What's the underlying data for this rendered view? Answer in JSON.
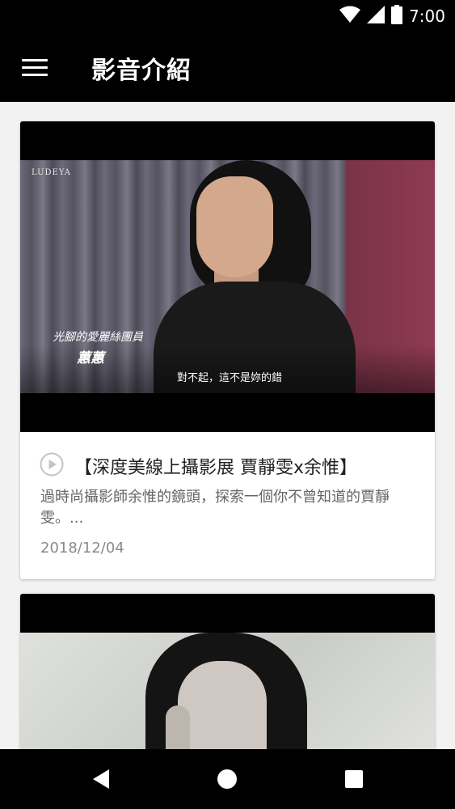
{
  "status_bar": {
    "time": "7:00",
    "icons": [
      "wifi-icon",
      "signal-icon",
      "battery-icon"
    ]
  },
  "app_bar": {
    "menu_icon": "hamburger-menu-icon",
    "title": "影音介紹"
  },
  "videos": [
    {
      "thumbnail": {
        "watermark": "LUDEYA",
        "subtitle_line1": "光腳的愛麗絲團員",
        "subtitle_line2": "蕙蕙",
        "caption": "對不起，這不是妳的錯"
      },
      "play_icon": "play-circle-icon",
      "title": "【深度美線上攝影展  賈靜雯x余惟】",
      "description": "過時尚攝影師余惟的鏡頭，探索一個你不曾知道的賈靜雯。...",
      "date": "2018/12/04"
    },
    {
      "thumbnail": {}
    }
  ],
  "nav_bar": {
    "back_icon": "back-triangle-icon",
    "home_icon": "home-circle-icon",
    "recents_icon": "recents-square-icon"
  },
  "colors": {
    "bar_background": "#000000",
    "page_background": "#f2f2f2",
    "card_background": "#ffffff",
    "title_text": "#222222",
    "secondary_text": "#666666"
  }
}
